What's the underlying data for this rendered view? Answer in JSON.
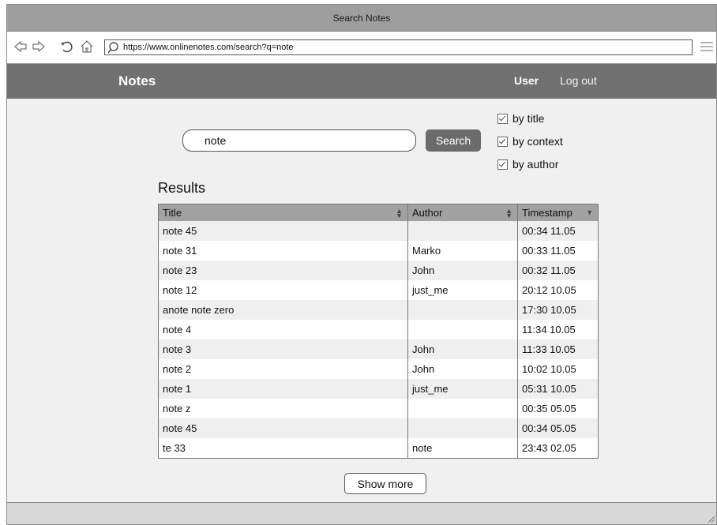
{
  "window": {
    "title": "Search Notes"
  },
  "browser": {
    "url": "https://www.onlinenotes.com/search?q=note",
    "icons": [
      "back-icon",
      "forward-icon",
      "reload-icon",
      "home-icon",
      "search-icon",
      "menu-icon"
    ]
  },
  "appbar": {
    "brand": "Notes",
    "user": "User",
    "logout": "Log out"
  },
  "search": {
    "query": "note",
    "button": "Search",
    "filters": [
      {
        "label": "by title",
        "checked": true
      },
      {
        "label": "by context",
        "checked": true
      },
      {
        "label": "by author",
        "checked": true
      }
    ]
  },
  "results": {
    "heading": "Results",
    "columns": [
      "Title",
      "Author",
      "Timestamp"
    ],
    "rows": [
      {
        "title": "note 45",
        "author": "",
        "timestamp": "00:34 11.05"
      },
      {
        "title": "note 31",
        "author": "Marko",
        "timestamp": "00:33 11.05"
      },
      {
        "title": "note 23",
        "author": "John",
        "timestamp": "00:32 11.05"
      },
      {
        "title": "note 12",
        "author": "just_me",
        "timestamp": "20:12 10.05"
      },
      {
        "title": "anote note zero",
        "author": "",
        "timestamp": "17:30 10.05"
      },
      {
        "title": "note 4",
        "author": "",
        "timestamp": "11:34 10.05"
      },
      {
        "title": "note 3",
        "author": "John",
        "timestamp": "11:33 10.05"
      },
      {
        "title": "note 2",
        "author": "John",
        "timestamp": "10:02 10.05"
      },
      {
        "title": "note 1",
        "author": "just_me",
        "timestamp": "05:31 10.05"
      },
      {
        "title": "note z",
        "author": "",
        "timestamp": "00:35 05.05"
      },
      {
        "title": "note 45",
        "author": "",
        "timestamp": "00:34 05.05"
      },
      {
        "title": "te 33",
        "author": "note",
        "timestamp": "23:43 02.05"
      }
    ],
    "show_more": "Show more"
  }
}
